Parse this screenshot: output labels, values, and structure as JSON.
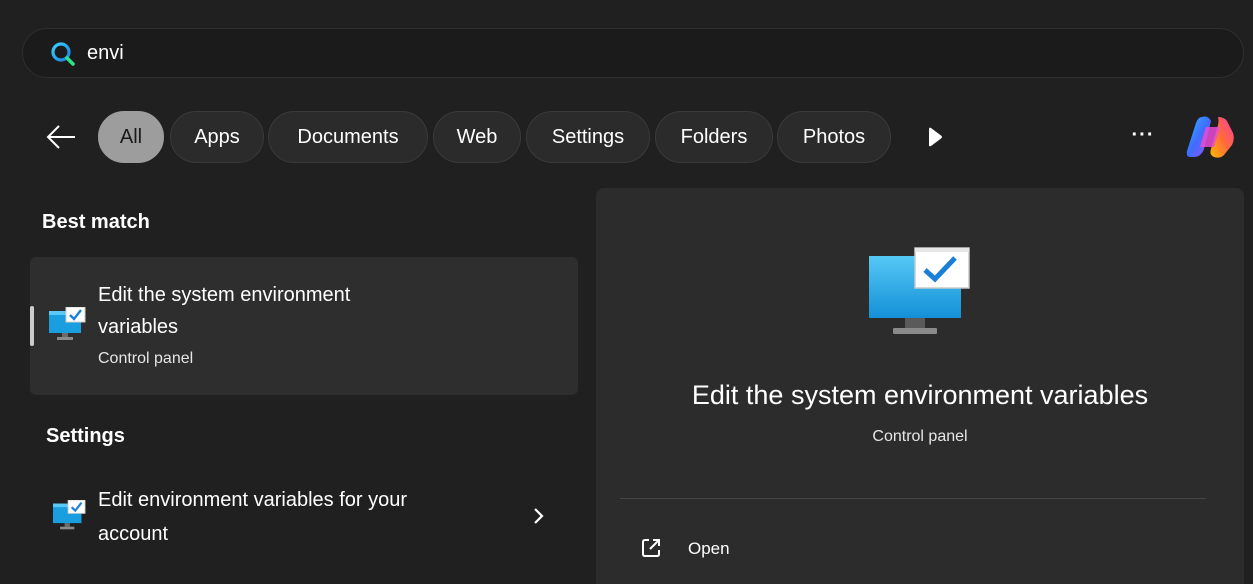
{
  "search": {
    "query": "envi"
  },
  "filters": {
    "back_label": "Back",
    "chips": [
      {
        "label": "All",
        "active": true
      },
      {
        "label": "Apps",
        "active": false
      },
      {
        "label": "Documents",
        "active": false
      },
      {
        "label": "Web",
        "active": false
      },
      {
        "label": "Settings",
        "active": false
      },
      {
        "label": "Folders",
        "active": false
      },
      {
        "label": "Photos",
        "active": false
      }
    ],
    "more_icon": "play-icon",
    "ellipsis_label": "···",
    "copilot_icon": "copilot-icon"
  },
  "results": {
    "best_match_header": "Best match",
    "best_match": {
      "title_line1": "Edit the system environment",
      "title_line2": "variables",
      "subtitle": "Control panel",
      "icon": "monitor-check-icon"
    },
    "settings_header": "Settings",
    "settings_item": {
      "title_line1": "Edit environment variables for your",
      "title_line2": "account",
      "icon": "monitor-check-icon"
    }
  },
  "preview": {
    "title": "Edit the system environment variables",
    "subtitle": "Control panel",
    "icon": "monitor-check-icon",
    "actions": [
      {
        "label": "Open",
        "icon": "open-external-icon"
      }
    ]
  },
  "colors": {
    "background": "#202020",
    "pane": "#2c2c2c",
    "active_chip": "#9d9d9d",
    "monitor_blue": "#1a9ee0"
  }
}
